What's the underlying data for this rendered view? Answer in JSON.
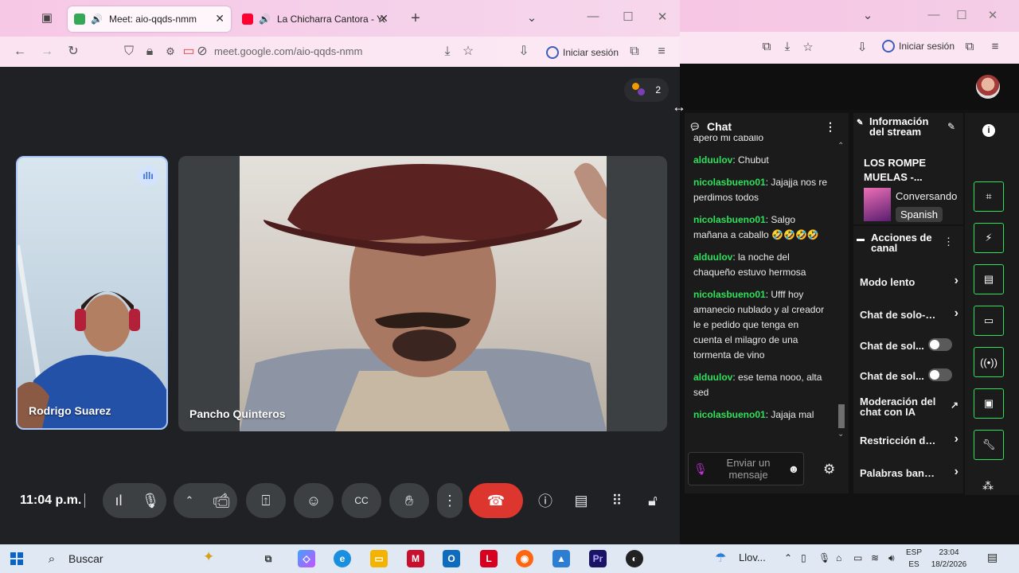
{
  "left_browser": {
    "tabs": [
      {
        "title": "Meet: aio-qqds-nmm",
        "active": true,
        "favicon_color": "#34a853"
      },
      {
        "title": "La Chicharra Cantora - YouT",
        "active": false,
        "favicon_color": "#ff0033"
      }
    ],
    "url": "meet.google.com/aio-qqds-nmm",
    "signin_label": "Iniciar sesión"
  },
  "meet": {
    "participant_count": "2",
    "participants": [
      {
        "name": "Rodrigo Suarez"
      },
      {
        "name": "Pancho Quinteros"
      }
    ],
    "clock": "11:04 p.m."
  },
  "right_browser": {
    "signin_label": "Iniciar sesión"
  },
  "chat": {
    "title": "Chat",
    "username_color": "#2fe05b",
    "first_partial": "apero mi caballo",
    "messages": [
      {
        "user": "alduulov",
        "text": "Chubut"
      },
      {
        "user": "nicolasbueno01",
        "text": "Jajajja nos re perdimos todos"
      },
      {
        "user": "nicolasbueno01",
        "text": "Salgo mañana a caballo 🤣🤣🤣🤣"
      },
      {
        "user": "alduulov",
        "text": "la noche del chaqueño estuvo hermosa"
      },
      {
        "user": "nicolasbueno01",
        "text": "Ufff hoy amanecio nublado y al creador le e pedido que tenga en cuenta el milagro de una tormenta de vino"
      },
      {
        "user": "alduulov",
        "text": "ese tema nooo, alta sed"
      },
      {
        "user": "nicolasbueno01",
        "text": "Jajaja mal"
      }
    ],
    "input_placeholder": "Enviar un mensaje"
  },
  "stream_info": {
    "title": "Información del stream",
    "stream_title": "LOS ROMPE MUELAS -...",
    "category": "Conversando",
    "language": "Spanish"
  },
  "channel_actions": {
    "title": "Acciones de canal",
    "items": [
      {
        "label": "Modo lento",
        "control": "chevron"
      },
      {
        "label": "Chat de solo-se",
        "control": "chevron"
      },
      {
        "label": "Chat de sol...",
        "control": "toggle"
      },
      {
        "label": "Chat de sol...",
        "control": "toggle"
      },
      {
        "label": "Moderación del chat con IA",
        "control": "external"
      },
      {
        "label": "Restricción de c",
        "control": "chevron"
      },
      {
        "label": "Palabras baneadas",
        "control": "chevron"
      }
    ]
  },
  "rail_icons": [
    "clip-icon",
    "bolt-icon",
    "document-icon",
    "chat-bubble-icon",
    "broadcast-icon",
    "layout-icon",
    "wrench-icon",
    "extensions-icon"
  ],
  "taskbar": {
    "search_label": "Buscar",
    "weather": "Llov...",
    "lang": "ESP",
    "lang2": "ES",
    "time": "23:04",
    "date": "18/2/2026"
  },
  "colors": {
    "hangup": "#dc362e",
    "accent_green": "#2fe05b",
    "active_tile_border": "#a8c7fa"
  }
}
